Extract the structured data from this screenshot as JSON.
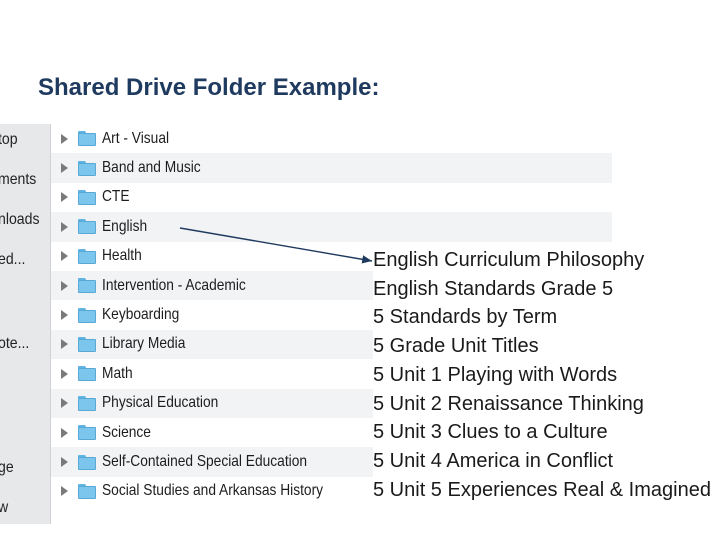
{
  "slide": {
    "title": "Shared Drive Folder Example:"
  },
  "sidebar": {
    "items": [
      {
        "label": "top"
      },
      {
        "label": "ments"
      },
      {
        "label": "nloads"
      },
      {
        "label": "ed..."
      },
      {
        "label": "ote..."
      },
      {
        "label": "ge"
      },
      {
        "label": "w"
      }
    ]
  },
  "folders": [
    {
      "label": "Art - Visual"
    },
    {
      "label": "Band and Music"
    },
    {
      "label": "CTE"
    },
    {
      "label": "English"
    },
    {
      "label": "Health"
    },
    {
      "label": "Intervention - Academic"
    },
    {
      "label": "Keyboarding"
    },
    {
      "label": "Library Media"
    },
    {
      "label": "Math"
    },
    {
      "label": "Physical Education"
    },
    {
      "label": "Science"
    },
    {
      "label": "Self-Contained Special Education"
    },
    {
      "label": "Social Studies and Arkansas History"
    }
  ],
  "english_contents": [
    "English Curriculum Philosophy",
    "English Standards Grade 5",
    "5 Standards by Term",
    "5 Grade Unit Titles",
    "5 Unit 1 Playing with Words",
    "5 Unit 2 Renaissance Thinking",
    "5 Unit 3 Clues to a Culture",
    "5 Unit 4 America in Conflict",
    "5 Unit 5 Experiences Real & Imagined"
  ],
  "colors": {
    "title": "#1f3a5f",
    "folder": "#7cc6ee",
    "row_alt": "#f2f3f5",
    "arrow": "#1f3a5f"
  }
}
